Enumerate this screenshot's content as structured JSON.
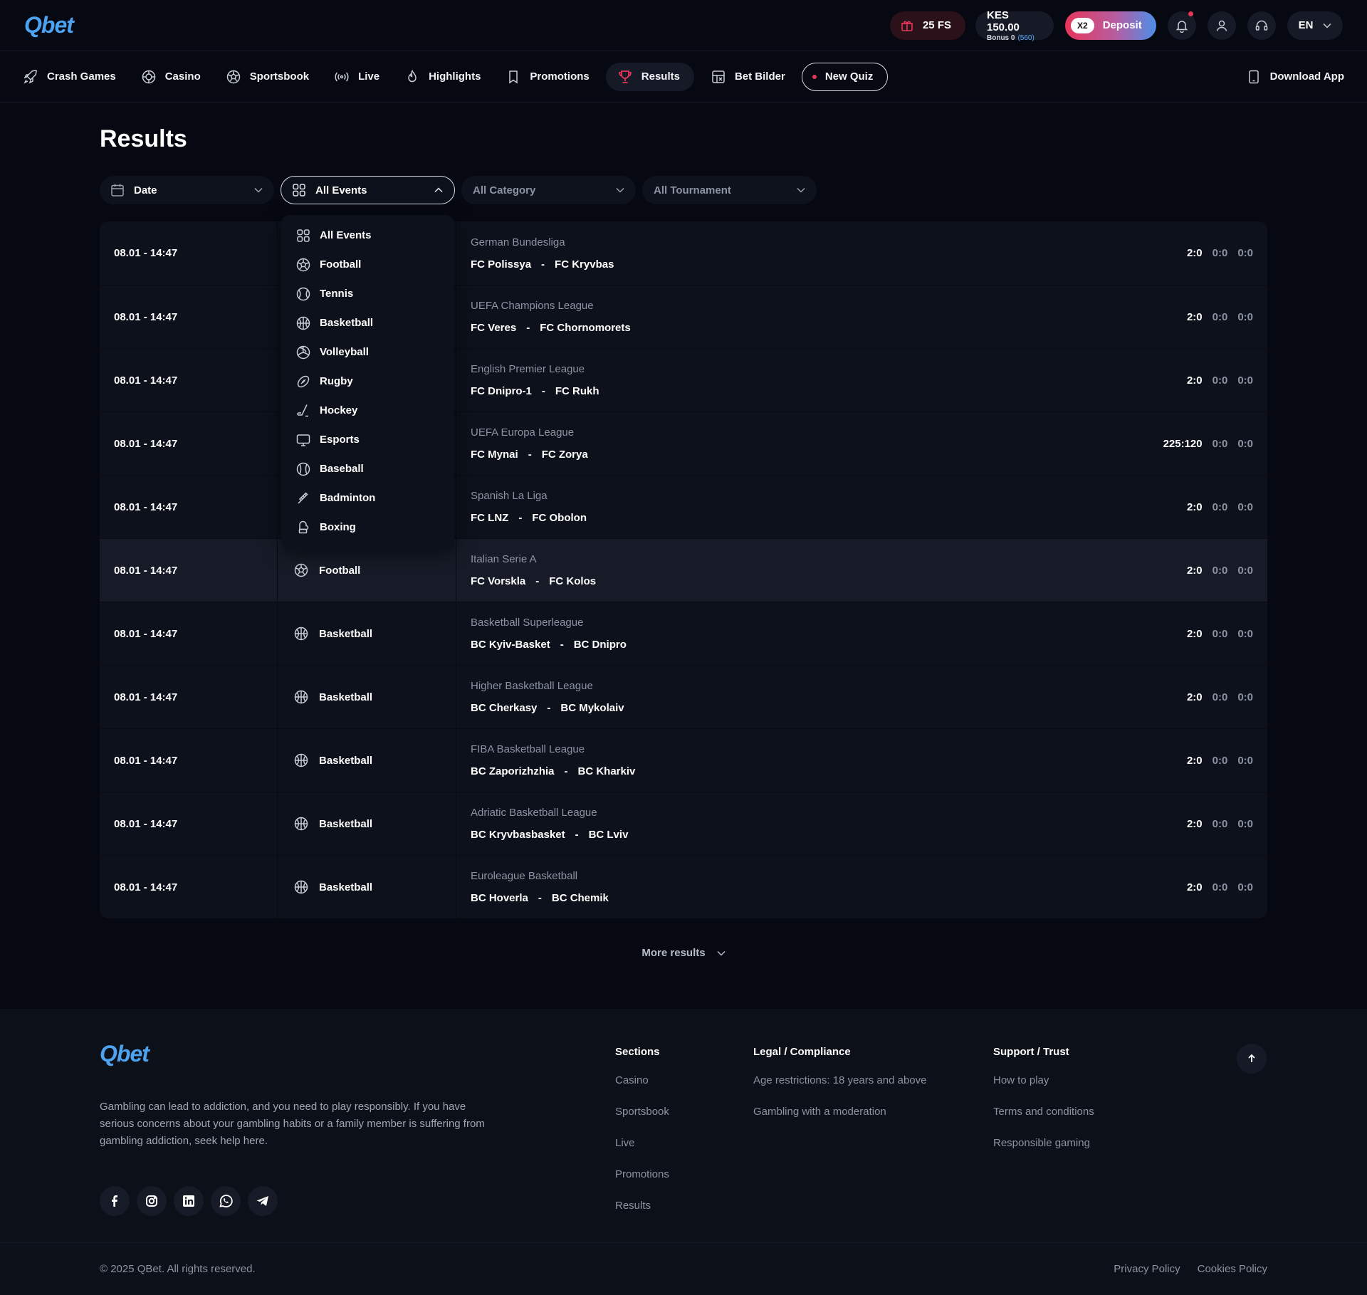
{
  "header": {
    "logo": "Qbet",
    "free_spins": "25 FS",
    "balance": "KES 150.00",
    "bonus_label": "Bonus 0",
    "bonus_extra": "(560)",
    "deposit_badge": "X2",
    "deposit_label": "Deposit",
    "language": "EN"
  },
  "nav": {
    "items": [
      {
        "label": "Crash Games",
        "icon": "rocket-icon"
      },
      {
        "label": "Casino",
        "icon": "chip-icon"
      },
      {
        "label": "Sportsbook",
        "icon": "soccer-ball-icon"
      },
      {
        "label": "Live",
        "icon": "broadcast-icon"
      },
      {
        "label": "Highlights",
        "icon": "flame-icon"
      },
      {
        "label": "Promotions",
        "icon": "bookmark-icon"
      },
      {
        "label": "Results",
        "icon": "trophy-icon"
      },
      {
        "label": "Bet Bilder",
        "icon": "builder-icon"
      }
    ],
    "quiz_label": "New Quiz",
    "download_label": "Download App"
  },
  "page": {
    "title": "Results",
    "filters": {
      "date": "Date",
      "events": "All Events",
      "category": "All Category",
      "tournament": "All Tournament"
    },
    "more_results": "More results"
  },
  "dropdown": {
    "items": [
      {
        "label": "All Events",
        "icon": "grid-icon"
      },
      {
        "label": "Football",
        "icon": "football-icon"
      },
      {
        "label": "Tennis",
        "icon": "tennis-icon"
      },
      {
        "label": "Basketball",
        "icon": "basketball-icon"
      },
      {
        "label": "Volleyball",
        "icon": "volleyball-icon"
      },
      {
        "label": "Rugby",
        "icon": "rugby-icon"
      },
      {
        "label": "Hockey",
        "icon": "hockey-icon"
      },
      {
        "label": "Esports",
        "icon": "monitor-icon"
      },
      {
        "label": "Baseball",
        "icon": "baseball-icon"
      },
      {
        "label": "Badminton",
        "icon": "badminton-icon"
      },
      {
        "label": "Boxing",
        "icon": "boxing-glove-icon"
      }
    ]
  },
  "results": [
    {
      "date": "08.01 - 14:47",
      "sport": "",
      "league": "German Bundesliga",
      "home": "FC Polissya",
      "sep": "-",
      "away": "FC Kryvbas",
      "score": "2:0",
      "p1": "0:0",
      "p2": "0:0"
    },
    {
      "date": "08.01 - 14:47",
      "sport": "",
      "league": "UEFA Champions League",
      "home": "FC Veres",
      "sep": "-",
      "away": "FC Chornomorets",
      "score": "2:0",
      "p1": "0:0",
      "p2": "0:0"
    },
    {
      "date": "08.01 - 14:47",
      "sport": "",
      "league": "English Premier League",
      "home": "FC Dnipro-1",
      "sep": "-",
      "away": "FC Rukh",
      "score": "2:0",
      "p1": "0:0",
      "p2": "0:0"
    },
    {
      "date": "08.01 - 14:47",
      "sport": "",
      "league": "UEFA Europa League",
      "home": "FC Mynai",
      "sep": "-",
      "away": "FC Zorya",
      "score": "225:120",
      "p1": "0:0",
      "p2": "0:0"
    },
    {
      "date": "08.01 - 14:47",
      "sport": "",
      "league": "Spanish La Liga",
      "home": "FC LNZ",
      "sep": "-",
      "away": "FC Obolon",
      "score": "2:0",
      "p1": "0:0",
      "p2": "0:0"
    },
    {
      "date": "08.01 - 14:47",
      "sport": "Football",
      "league": "Italian Serie A",
      "home": "FC Vorskla",
      "sep": "-",
      "away": "FC Kolos",
      "score": "2:0",
      "p1": "0:0",
      "p2": "0:0"
    },
    {
      "date": "08.01 - 14:47",
      "sport": "Basketball",
      "league": "Basketball Superleague",
      "home": "BC Kyiv-Basket",
      "sep": "-",
      "away": "BC Dnipro",
      "score": "2:0",
      "p1": "0:0",
      "p2": "0:0"
    },
    {
      "date": "08.01 - 14:47",
      "sport": "Basketball",
      "league": "Higher Basketball League",
      "home": "BC Cherkasy",
      "sep": "-",
      "away": "BC Mykolaiv",
      "score": "2:0",
      "p1": "0:0",
      "p2": "0:0"
    },
    {
      "date": "08.01 - 14:47",
      "sport": "Basketball",
      "league": "FIBA Basketball League",
      "home": "BC Zaporizhzhia",
      "sep": "-",
      "away": "BC Kharkiv",
      "score": "2:0",
      "p1": "0:0",
      "p2": "0:0"
    },
    {
      "date": "08.01 - 14:47",
      "sport": "Basketball",
      "league": "Adriatic Basketball League",
      "home": "BC Kryvbasbasket",
      "sep": "-",
      "away": "BC Lviv",
      "score": "2:0",
      "p1": "0:0",
      "p2": "0:0"
    },
    {
      "date": "08.01 - 14:47",
      "sport": "Basketball",
      "league": "Euroleague Basketball",
      "home": "BC Hoverla",
      "sep": "-",
      "away": "BC Chemik",
      "score": "2:0",
      "p1": "0:0",
      "p2": "0:0"
    }
  ],
  "footer": {
    "logo": "Qbet",
    "disclaimer": "Gambling can lead to addiction, and you need to play responsibly. If you have serious concerns about your gambling habits or a family member is suffering from gambling addiction, seek help here.",
    "sections": {
      "title": "Sections",
      "links": [
        "Casino",
        "Sportsbook",
        "Live",
        "Promotions",
        "Results"
      ]
    },
    "legal": {
      "title": "Legal / Compliance",
      "links": [
        "Age restrictions: 18 years and above",
        "Gambling with a moderation"
      ]
    },
    "support": {
      "title": "Support / Trust",
      "links": [
        "How to play",
        "Terms and conditions",
        "Responsible gaming"
      ]
    },
    "socials": [
      "facebook-icon",
      "instagram-icon",
      "linkedin-icon",
      "whatsapp-icon",
      "telegram-icon"
    ],
    "copyright": "© 2025 QBet. All rights reserved.",
    "privacy": "Privacy Policy",
    "cookies": "Cookies Policy"
  },
  "colors": {
    "background": "#060912",
    "panel": "#0d111b",
    "accent_red": "#e8355a",
    "accent_blue": "#4da3f0",
    "muted_text": "#8c93a3"
  }
}
